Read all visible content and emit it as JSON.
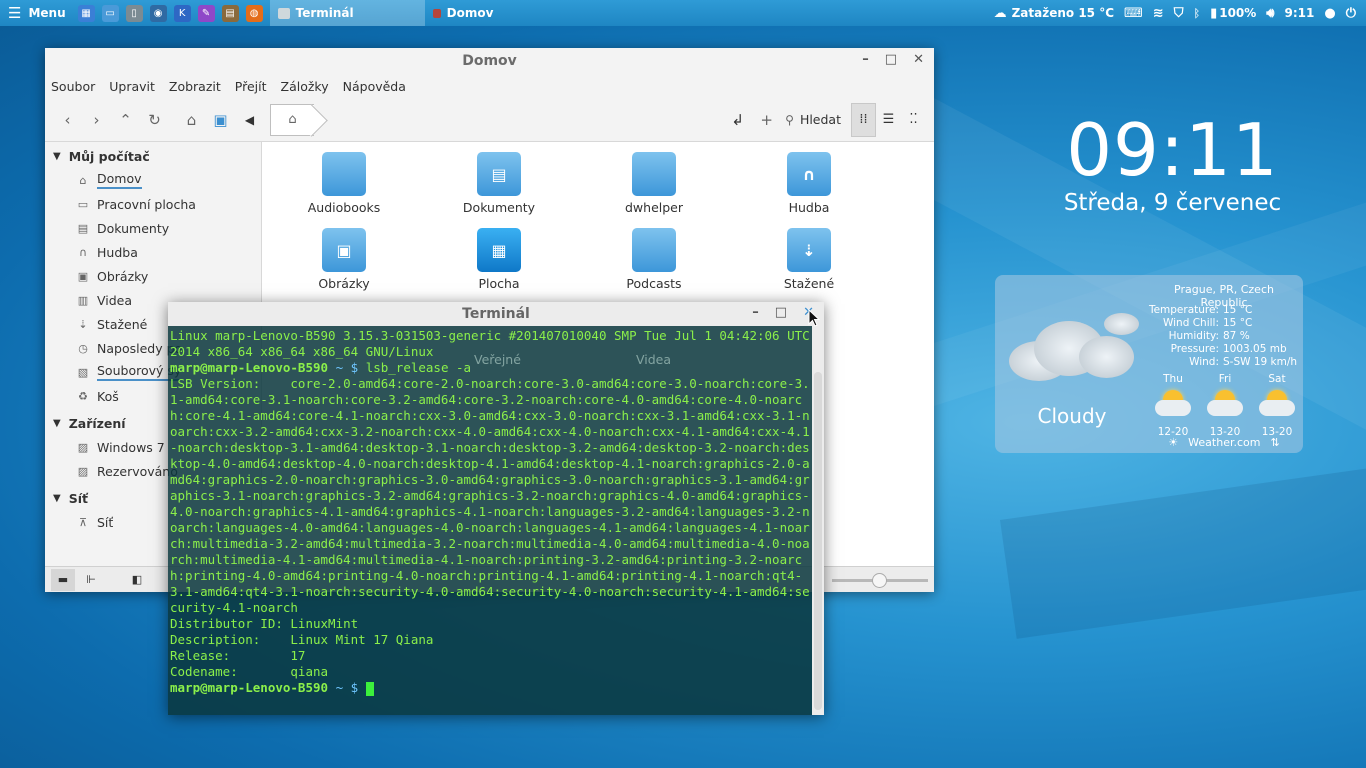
{
  "panel": {
    "menu_label": "Menu",
    "launchers": [
      {
        "icon": "calculator-icon",
        "color": "#3a7fd6"
      },
      {
        "icon": "files-icon",
        "color": "#4a9ad8"
      },
      {
        "icon": "terminal-launcher-icon",
        "color": "#7b8b93"
      },
      {
        "icon": "camera-icon",
        "color": "#2f6aa3"
      },
      {
        "icon": "kodi-icon",
        "color": "#2e67c4"
      },
      {
        "icon": "paint-icon",
        "color": "#8f48c8"
      },
      {
        "icon": "image-viewer-icon",
        "color": "#8a6a3c"
      },
      {
        "icon": "firefox-icon",
        "color": "#e46d1a"
      }
    ],
    "tasks": [
      {
        "label": "Terminál",
        "active": true
      },
      {
        "label": "Domov",
        "active": false
      }
    ],
    "weather_text": "Zataženo 15 °C",
    "battery": "100%",
    "time": "9:11"
  },
  "files_window": {
    "title": "Domov",
    "menu": [
      "Soubor",
      "Upravit",
      "Zobrazit",
      "Přejít",
      "Záložky",
      "Nápověda"
    ],
    "search_label": "Hledat",
    "sections": [
      {
        "title": "Můj počítač",
        "items": [
          {
            "label": "Domov",
            "icon": "home-icon"
          },
          {
            "label": "Pracovní plocha",
            "icon": "desktop-icon"
          },
          {
            "label": "Dokumenty",
            "icon": "documents-icon"
          },
          {
            "label": "Hudba",
            "icon": "music-icon"
          },
          {
            "label": "Obrázky",
            "icon": "pictures-icon"
          },
          {
            "label": "Videa",
            "icon": "videos-icon"
          },
          {
            "label": "Stažené",
            "icon": "downloads-icon"
          },
          {
            "label": "Naposledy po",
            "icon": "recent-icon"
          },
          {
            "label": "Souborový sy",
            "icon": "filesystem-icon"
          },
          {
            "label": "Koš",
            "icon": "trash-icon"
          }
        ]
      },
      {
        "title": "Zařízení",
        "items": [
          {
            "label": "Windows 7",
            "icon": "drive-icon"
          },
          {
            "label": "Rezervováno",
            "icon": "drive-icon"
          }
        ]
      },
      {
        "title": "Síť",
        "items": [
          {
            "label": "Síť",
            "icon": "network-icon"
          }
        ]
      }
    ],
    "folders": [
      {
        "label": "Audiobooks",
        "glyph": ""
      },
      {
        "label": "Dokumenty",
        "glyph": "▤"
      },
      {
        "label": "dwhelper",
        "glyph": ""
      },
      {
        "label": "Hudba",
        "glyph": "∩"
      },
      {
        "label": "Obrázky",
        "glyph": "▣"
      },
      {
        "label": "Plocha",
        "glyph": "▦"
      },
      {
        "label": "Podcasts",
        "glyph": ""
      },
      {
        "label": "Stažené",
        "glyph": "⇣"
      }
    ],
    "hidden_folders": [
      "Veřejné",
      "Videa"
    ]
  },
  "terminal": {
    "title": "Terminál",
    "uname_output": "Linux marp-Lenovo-B590 3.15.3-031503-generic #201407010040 SMP Tue Jul 1 04:42:06 UTC 2014 x86_64 x86_64 x86_64 GNU/Linux",
    "prompt_user": "marp@marp-Lenovo-B590",
    "prompt_path": " ~ $ ",
    "command": "lsb_release -a",
    "lsb_version": "LSB Version:    core-2.0-amd64:core-2.0-noarch:core-3.0-amd64:core-3.0-noarch:core-3.1-amd64:core-3.1-noarch:core-3.2-amd64:core-3.2-noarch:core-4.0-amd64:core-4.0-noarch:core-4.1-amd64:core-4.1-noarch:cxx-3.0-amd64:cxx-3.0-noarch:cxx-3.1-amd64:cxx-3.1-noarch:cxx-3.2-amd64:cxx-3.2-noarch:cxx-4.0-amd64:cxx-4.0-noarch:cxx-4.1-amd64:cxx-4.1-noarch:desktop-3.1-amd64:desktop-3.1-noarch:desktop-3.2-amd64:desktop-3.2-noarch:desktop-4.0-amd64:desktop-4.0-noarch:desktop-4.1-amd64:desktop-4.1-noarch:graphics-2.0-amd64:graphics-2.0-noarch:graphics-3.0-amd64:graphics-3.0-noarch:graphics-3.1-amd64:graphics-3.1-noarch:graphics-3.2-amd64:graphics-3.2-noarch:graphics-4.0-amd64:graphics-4.0-noarch:graphics-4.1-amd64:graphics-4.1-noarch:languages-3.2-amd64:languages-3.2-noarch:languages-4.0-amd64:languages-4.0-noarch:languages-4.1-amd64:languages-4.1-noarch:multimedia-3.2-amd64:multimedia-3.2-noarch:multimedia-4.0-amd64:multimedia-4.0-noarch:multimedia-4.1-amd64:multimedia-4.1-noarch:printing-3.2-amd64:printing-3.2-noarch:printing-4.0-amd64:printing-4.0-noarch:printing-4.1-amd64:printing-4.1-noarch:qt4-3.1-amd64:qt4-3.1-noarch:security-4.0-amd64:security-4.0-noarch:security-4.1-amd64:security-4.1-noarch",
    "distributor": "Distributor ID: LinuxMint",
    "description": "Description:    Linux Mint 17 Qiana",
    "release": "Release:        17",
    "codename": "Codename:       qiana"
  },
  "clock": {
    "time": "09:11",
    "date": "Středa, 9 červenec"
  },
  "weather": {
    "location": "Prague, PR, Czech Republic",
    "condition": "Cloudy",
    "details": [
      {
        "k": "Temperature:",
        "v": "15 °C"
      },
      {
        "k": "Wind Chill:",
        "v": "15 °C"
      },
      {
        "k": "Humidity:",
        "v": "87 %"
      },
      {
        "k": "Pressure:",
        "v": "1003.05 mb"
      },
      {
        "k": "Wind:",
        "v": "S-SW 19 km/h"
      }
    ],
    "forecast": [
      {
        "day": "Thu",
        "range": "12-20"
      },
      {
        "day": "Fri",
        "range": "13-20"
      },
      {
        "day": "Sat",
        "range": "13-20"
      }
    ],
    "provider": "Weather.com"
  }
}
